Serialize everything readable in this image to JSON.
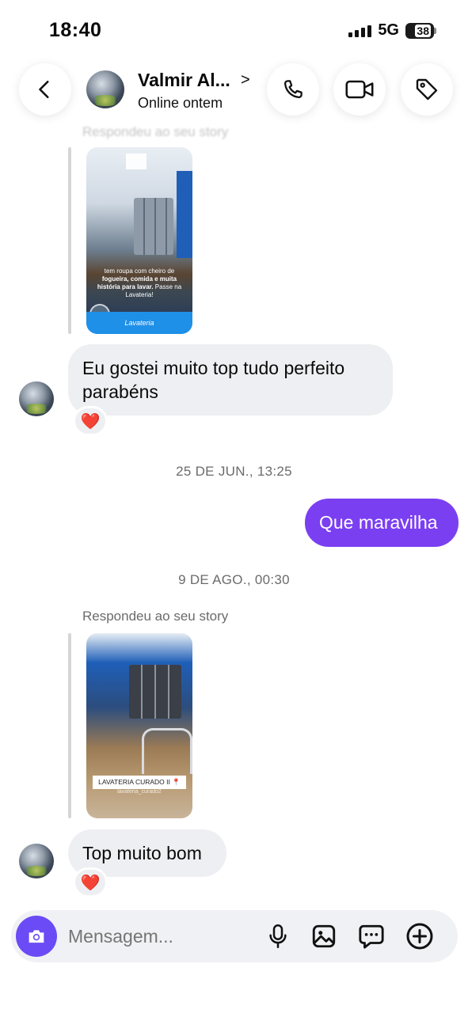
{
  "status_bar": {
    "time": "18:40",
    "network": "5G",
    "battery": "38"
  },
  "header": {
    "contact_name": "Valmir Al...",
    "status": "Online ontem",
    "chevron": ">"
  },
  "thread": {
    "ghost_label": "Respondeu ao seu story",
    "story1": {
      "caption_line1": "tem roupa com cheiro de",
      "caption_bold": "fogueira, comida e muita história para lavar.",
      "caption_line3": "Passe na Lavateria!",
      "brand": "Lavateria"
    },
    "msg1": {
      "text": "Eu gostei muito top  tudo perfeito parabéns",
      "reaction": "❤️"
    },
    "timestamp1": "25 DE JUN., 13:25",
    "msg2": {
      "text": "Que maravilha"
    },
    "timestamp2": "9 DE AGO., 00:30",
    "story_reply_label": "Respondeu ao seu story",
    "story2": {
      "tag": "LAVATERIA CURADO II 📍",
      "sub": "lavateria_curado2"
    },
    "msg3": {
      "text": "Top muito bom",
      "reaction": "❤️"
    }
  },
  "composer": {
    "placeholder": "Mensagem..."
  },
  "colors": {
    "accent": "#7b3ff2",
    "camera_button": "#6a4bf5",
    "incoming_bubble": "#eeeff2"
  },
  "icons": [
    "back-arrow-icon",
    "phone-icon",
    "video-call-icon",
    "tag-icon",
    "camera-icon",
    "microphone-icon",
    "gallery-icon",
    "sticker-icon",
    "plus-icon",
    "heart-icon"
  ]
}
